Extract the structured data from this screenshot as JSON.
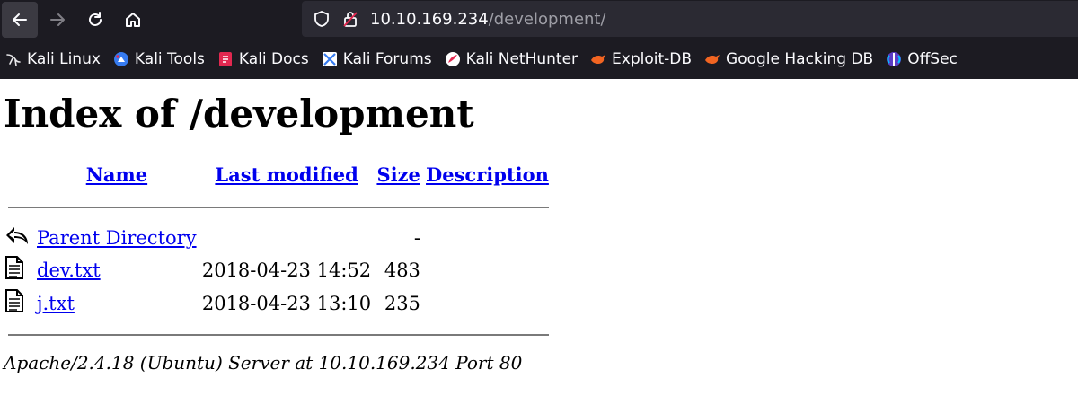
{
  "browser": {
    "url_host": "10.10.169.234",
    "url_path": "/development/",
    "bookmarks": [
      {
        "label": "Kali Linux",
        "icon": "kali-dragon-icon"
      },
      {
        "label": "Kali Tools",
        "icon": "kali-tools-icon"
      },
      {
        "label": "Kali Docs",
        "icon": "kali-docs-icon"
      },
      {
        "label": "Kali Forums",
        "icon": "kali-forums-icon"
      },
      {
        "label": "Kali NetHunter",
        "icon": "kali-nethunter-icon"
      },
      {
        "label": "Exploit-DB",
        "icon": "exploit-db-icon"
      },
      {
        "label": "Google Hacking DB",
        "icon": "ghdb-icon"
      },
      {
        "label": "OffSec",
        "icon": "offsec-icon"
      }
    ]
  },
  "page": {
    "title": "Index of /development",
    "columns": {
      "name": "Name",
      "last_modified": "Last modified",
      "size": "Size",
      "description": "Description"
    },
    "rows": [
      {
        "name": "Parent Directory",
        "modified": "",
        "size": "-",
        "icon": "back-arrow-icon"
      },
      {
        "name": "dev.txt",
        "modified": "2018-04-23 14:52",
        "size": "483",
        "icon": "text-file-icon"
      },
      {
        "name": "j.txt",
        "modified": "2018-04-23 13:10",
        "size": "235",
        "icon": "text-file-icon"
      }
    ],
    "footer": "Apache/2.4.18 (Ubuntu) Server at 10.10.169.234 Port 80"
  },
  "colors": {
    "chrome_bg": "#1c1b22",
    "urlbar_bg": "#2b2a33",
    "link": "#0000ee"
  }
}
